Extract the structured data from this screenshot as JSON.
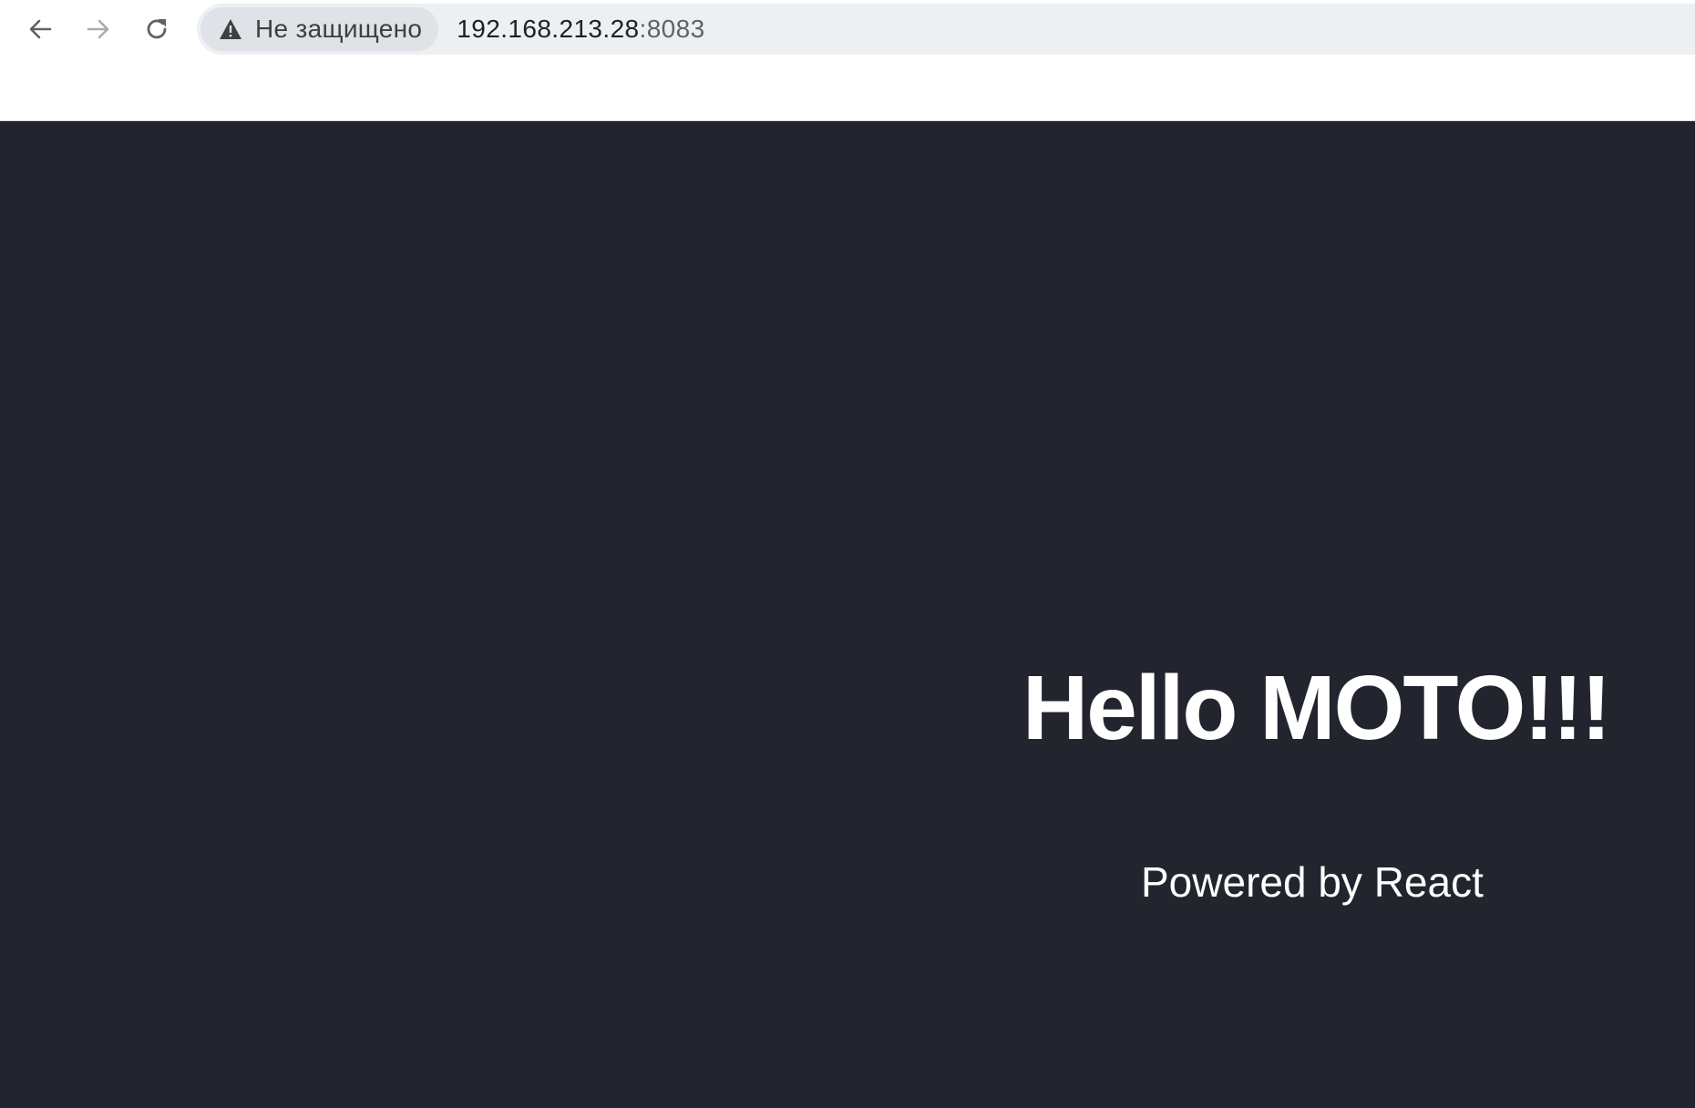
{
  "browser": {
    "security_label": "Не защищено",
    "url_host": "192.168.213.28",
    "url_port": ":8083",
    "icons": {
      "back": "arrow-left-icon",
      "forward": "arrow-right-icon",
      "reload": "reload-icon",
      "security": "warning-triangle-icon"
    }
  },
  "page": {
    "heading": "Hello MOTO!!!",
    "subtitle": "Powered by React",
    "background_color": "#22252d",
    "text_color": "#ffffff"
  }
}
